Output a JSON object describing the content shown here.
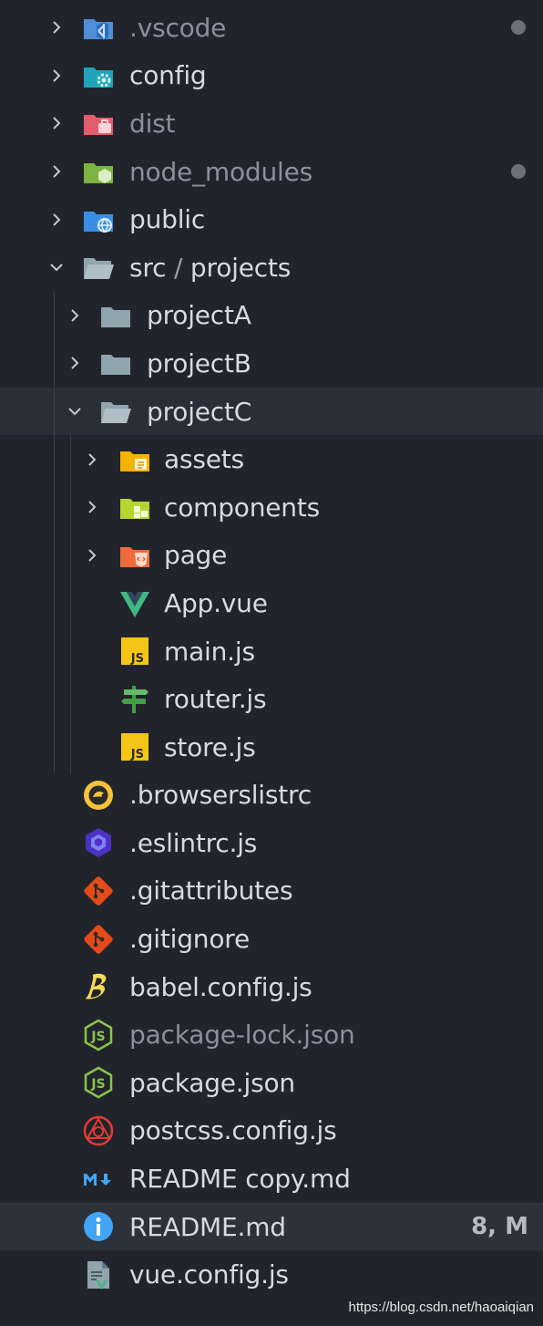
{
  "explorer": {
    "rows": [
      {
        "label": ".vscode",
        "dim": true,
        "dot": true
      },
      {
        "label": "config"
      },
      {
        "label": "dist",
        "dim": true
      },
      {
        "label": "node_modules",
        "dim": true,
        "dot": true
      },
      {
        "label": "public"
      },
      {
        "label_parts": [
          "src",
          "/",
          "projects"
        ]
      },
      {
        "label": "projectA"
      },
      {
        "label": "projectB"
      },
      {
        "label": "projectC"
      },
      {
        "label": "assets"
      },
      {
        "label": "components"
      },
      {
        "label": "page"
      },
      {
        "label": "App.vue"
      },
      {
        "label": "main.js"
      },
      {
        "label": "router.js"
      },
      {
        "label": "store.js"
      },
      {
        "label": ".browserslistrc"
      },
      {
        "label": ".eslintrc.js"
      },
      {
        "label": ".gitattributes"
      },
      {
        "label": ".gitignore"
      },
      {
        "label": "babel.config.js"
      },
      {
        "label": "package-lock.json",
        "dim": true
      },
      {
        "label": "package.json"
      },
      {
        "label": "postcss.config.js"
      },
      {
        "label": "README copy.md"
      },
      {
        "label": "README.md",
        "badge": "8, M"
      },
      {
        "label": "vue.config.js"
      }
    ]
  },
  "watermark": "https://blog.csdn.net/haoaiqian",
  "colors": {
    "background": "#21252b",
    "selected_row": "#2c313a",
    "text": "#d7dae0",
    "text_dim": "#8b919b"
  }
}
